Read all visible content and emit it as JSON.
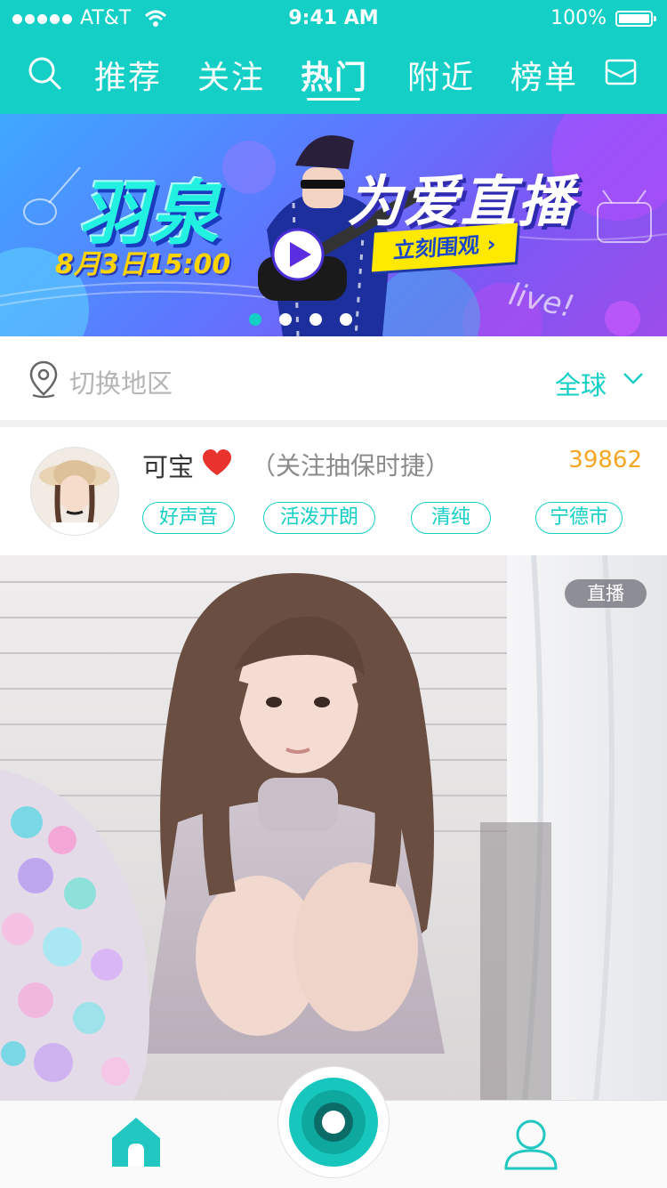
{
  "status_bar": {
    "carrier": "AT&T",
    "time": "9:41 AM",
    "battery": "100%"
  },
  "nav": {
    "tabs": [
      {
        "label": "推荐"
      },
      {
        "label": "关注"
      },
      {
        "label": "热门",
        "active": true
      },
      {
        "label": "附近"
      },
      {
        "label": "榜单"
      }
    ],
    "icons": [
      "search-icon",
      "mail-icon"
    ]
  },
  "banner": {
    "title_left": "羽泉",
    "title_right": "为爱直播",
    "date": "8月3日15:00",
    "cta": "立刻围观",
    "decor_text": "live!",
    "page_count": 4,
    "active_page": 1
  },
  "location": {
    "placeholder": "切换地区",
    "region": "全球"
  },
  "anchor": {
    "name": "可宝",
    "remark": "（关注抽保时捷）",
    "count": "39862",
    "tags": [
      "好声音",
      "活泼开朗",
      "清纯",
      "宁德市"
    ]
  },
  "cover": {
    "badge": "直播"
  },
  "tabbar": {
    "items": [
      "home-icon",
      "record-icon",
      "profile-icon"
    ]
  },
  "colors": {
    "accent": "#14cfc6",
    "count": "#f5a623",
    "heart": "#e8322d",
    "cta": "#ffe900"
  }
}
